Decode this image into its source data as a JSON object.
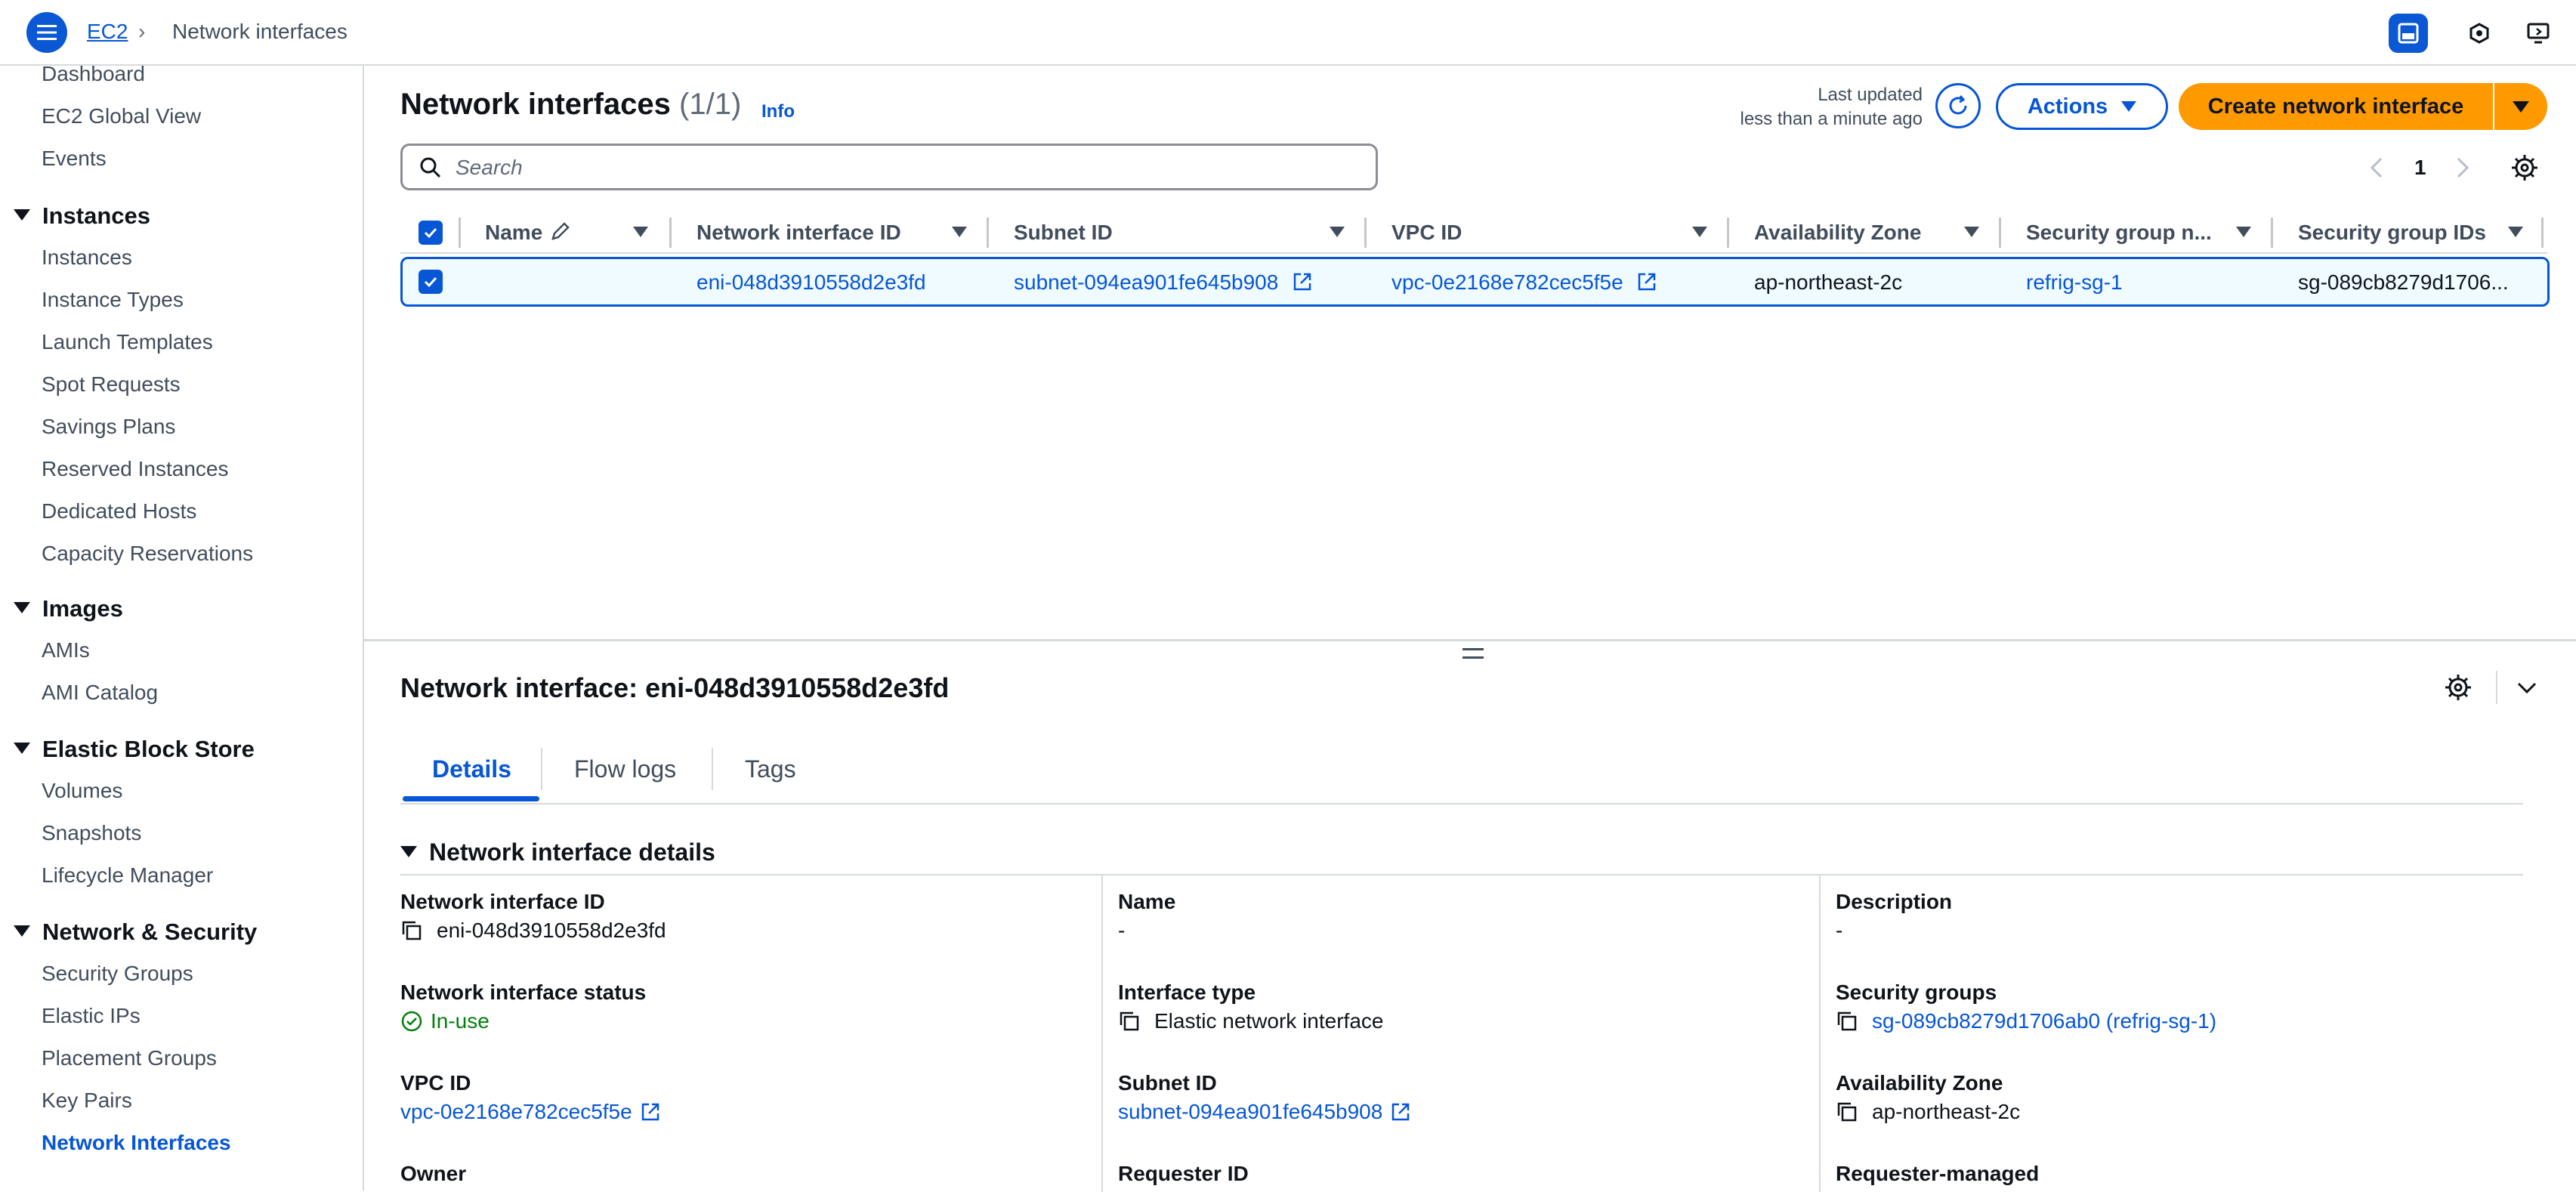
{
  "topbar": {
    "breadcrumb_root": "EC2",
    "breadcrumb_separator": "›",
    "breadcrumb_current": "Network interfaces"
  },
  "sidebar": {
    "items_top": [
      "Dashboard",
      "EC2 Global View",
      "Events"
    ],
    "instances": {
      "title": "Instances",
      "items": [
        "Instances",
        "Instance Types",
        "Launch Templates",
        "Spot Requests",
        "Savings Plans",
        "Reserved Instances",
        "Dedicated Hosts",
        "Capacity Reservations"
      ]
    },
    "images": {
      "title": "Images",
      "items": [
        "AMIs",
        "AMI Catalog"
      ]
    },
    "ebs": {
      "title": "Elastic Block Store",
      "items": [
        "Volumes",
        "Snapshots",
        "Lifecycle Manager"
      ]
    },
    "network": {
      "title": "Network & Security",
      "items": [
        "Security Groups",
        "Elastic IPs",
        "Placement Groups",
        "Key Pairs",
        "Network Interfaces"
      ]
    }
  },
  "header": {
    "title": "Network interfaces",
    "count": "(1/1)",
    "info": "Info",
    "last_updated_label": "Last updated",
    "last_updated_value": "less than a minute ago",
    "actions_label": "Actions",
    "create_label": "Create network interface"
  },
  "search": {
    "placeholder": "Search"
  },
  "pager": {
    "current_page": "1"
  },
  "table": {
    "columns": [
      "Name",
      "Network interface ID",
      "Subnet ID",
      "VPC ID",
      "Availability Zone",
      "Security group n...",
      "Security group IDs"
    ],
    "rows": [
      {
        "name": "",
        "eni_id": "eni-048d3910558d2e3fd",
        "subnet_id": "subnet-094ea901fe645b908",
        "vpc_id": "vpc-0e2168e782cec5f5e",
        "az": "ap-northeast-2c",
        "sg_name": "refrig-sg-1",
        "sg_ids": "sg-089cb8279d1706..."
      }
    ]
  },
  "split": {
    "title": "Network interface: eni-048d3910558d2e3fd",
    "tabs": [
      "Details",
      "Flow logs",
      "Tags"
    ],
    "section_title": "Network interface details",
    "fields": {
      "eni_id_label": "Network interface ID",
      "eni_id_value": "eni-048d3910558d2e3fd",
      "name_label": "Name",
      "name_value": "-",
      "description_label": "Description",
      "description_value": "-",
      "status_label": "Network interface status",
      "status_value": "In-use",
      "type_label": "Interface type",
      "type_value": "Elastic network interface",
      "sg_label": "Security groups",
      "sg_value": "sg-089cb8279d1706ab0 (refrig-sg-1)",
      "vpc_label": "VPC ID",
      "vpc_value": "vpc-0e2168e782cec5f5e",
      "subnet_label": "Subnet ID",
      "subnet_value": "subnet-094ea901fe645b908",
      "az_label": "Availability Zone",
      "az_value": "ap-northeast-2c",
      "owner_label": "Owner",
      "requester_label": "Requester ID",
      "requester_managed_label": "Requester-managed"
    }
  },
  "colors": {
    "primary": "#0656d6",
    "accent_orange": "#ff9900",
    "success": "#037f0c",
    "text": "#0f141a",
    "muted": "#414d5c"
  },
  "icons": [
    "menu-icon",
    "chevron-right-icon",
    "split-panel-icon",
    "hexagon-icon",
    "monitor-icon",
    "refresh-icon",
    "caret-down-icon",
    "search-icon",
    "chevron-left-icon",
    "gear-icon",
    "pencil-icon",
    "filter-icon",
    "external-link-icon",
    "drag-handle-icon",
    "chevron-down-icon",
    "copy-icon",
    "check-circle-icon"
  ]
}
